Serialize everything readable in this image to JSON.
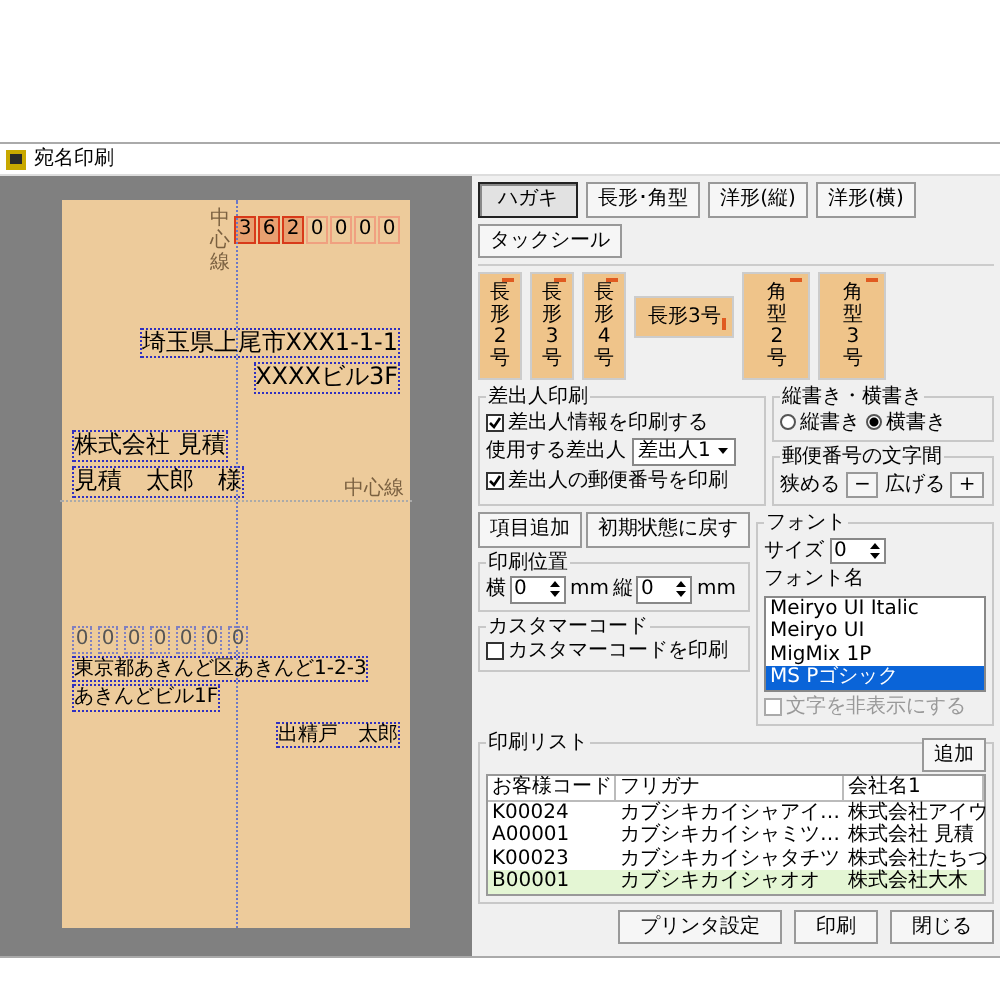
{
  "window": {
    "title": "宛名印刷"
  },
  "preview": {
    "postal_code": [
      "3",
      "6",
      "2",
      "0",
      "0",
      "0",
      "0"
    ],
    "center_labels": [
      "中心線",
      "中心線"
    ],
    "recipient": {
      "address": [
        "埼玉県上尾市XXX1-1-1",
        "XXXXビル3F"
      ],
      "company": "株式会社 見積",
      "name": "見積　太郎　様"
    },
    "sender": {
      "postal_code": [
        "0",
        "0",
        "0",
        "0",
        "0",
        "0",
        "0"
      ],
      "address": [
        "東京都あきんど区あきんど1-2-3",
        "あきんどビル1F"
      ],
      "name": "出精戸　太郎"
    }
  },
  "tabs": [
    {
      "label": "ハガキ",
      "selected": true
    },
    {
      "label": "長形･角型",
      "selected": false
    },
    {
      "label": "洋形(縦)",
      "selected": false
    },
    {
      "label": "洋形(横)",
      "selected": false
    },
    {
      "label": "タックシール",
      "selected": false
    }
  ],
  "envelopes": [
    {
      "label": "長形2号",
      "kind": "vertical"
    },
    {
      "label": "長形3号",
      "kind": "vertical"
    },
    {
      "label": "長形4号",
      "kind": "vertical"
    },
    {
      "label": "長形3号",
      "kind": "horizontal"
    },
    {
      "label": "角型2号",
      "kind": "wide"
    },
    {
      "label": "角型3号",
      "kind": "wide"
    }
  ],
  "sender_print": {
    "title": "差出人印刷",
    "print_info": {
      "label": "差出人情報を印刷する",
      "checked": true
    },
    "sender_label": "使用する差出人",
    "sender_select": "差出人1",
    "print_postal": {
      "label": "差出人の郵便番号を印刷",
      "checked": true
    }
  },
  "orientation": {
    "title": "縦書き・横書き",
    "options": [
      {
        "label": "縦書き",
        "selected": false
      },
      {
        "label": "横書き",
        "selected": true
      }
    ]
  },
  "postal_spacing": {
    "title": "郵便番号の文字間",
    "narrow_label": "狭める",
    "narrow_button": "−",
    "widen_label": "広げる",
    "widen_button": "+"
  },
  "action_buttons": [
    "項目追加",
    "初期状態に戻す"
  ],
  "print_position": {
    "title": "印刷位置",
    "x_label": "横",
    "x_value": "0",
    "x_unit": "mm",
    "y_label": "縦",
    "y_value": "0",
    "y_unit": "mm"
  },
  "customer_code": {
    "title": "カスタマーコード",
    "checkbox": {
      "label": "カスタマーコードを印刷",
      "checked": false
    }
  },
  "font": {
    "title": "フォント",
    "size_label": "サイズ",
    "size_value": "0",
    "name_label": "フォント名",
    "fonts": [
      {
        "name": "Meiryo UI Italic",
        "selected": false
      },
      {
        "name": "Meiryo UI",
        "selected": false
      },
      {
        "name": "MigMix 1P",
        "selected": false
      },
      {
        "name": "MS Pゴシック",
        "selected": true
      }
    ],
    "hide_text": {
      "label": "文字を非表示にする",
      "checked": false,
      "disabled": true
    }
  },
  "print_list": {
    "title": "印刷リスト",
    "add_button": "追加",
    "columns": [
      "お客様コード",
      "フリガナ",
      "会社名1"
    ],
    "rows": [
      {
        "cells": [
          "K00024",
          "カブシキカイシャアイ…",
          "株式会社アイウ"
        ],
        "highlighted": false
      },
      {
        "cells": [
          "A00001",
          "カブシキカイシャミツ…",
          "株式会社 見積"
        ],
        "highlighted": false
      },
      {
        "cells": [
          "K00023",
          "カブシキカイシャタチツ",
          "株式会社たちつ"
        ],
        "highlighted": false
      },
      {
        "cells": [
          "B00001",
          "カブシキカイシャオオ",
          "株式会社大木"
        ],
        "highlighted": true
      }
    ]
  },
  "footer_buttons": [
    "プリンタ設定",
    "印刷",
    "閉じる"
  ]
}
